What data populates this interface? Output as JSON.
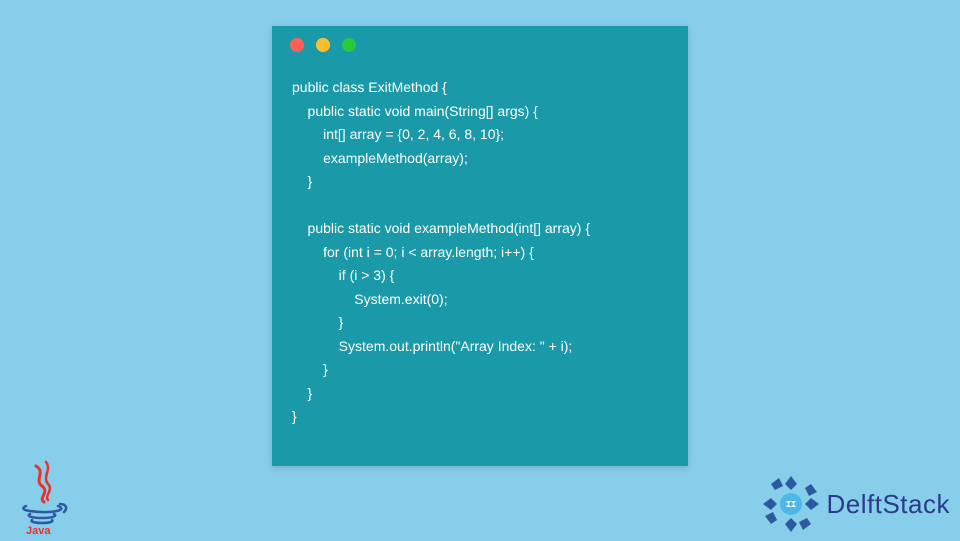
{
  "window": {
    "dots": [
      "red",
      "yellow",
      "green"
    ]
  },
  "code": {
    "lines": [
      "public class ExitMethod {",
      "    public static void main(String[] args) {",
      "        int[] array = {0, 2, 4, 6, 8, 10};",
      "        exampleMethod(array);",
      "    }",
      "",
      "    public static void exampleMethod(int[] array) {",
      "        for (int i = 0; i < array.length; i++) {",
      "            if (i > 3) {",
      "                System.exit(0);",
      "            }",
      "            System.out.println(\"Array Index: \" + i);",
      "        }",
      "    }",
      "}"
    ]
  },
  "logos": {
    "java_label": "Java",
    "delft_label": "DelftStack"
  },
  "colors": {
    "bg": "#87CEEB",
    "window": "#1A99A8",
    "text": "#FFFFFF",
    "delft": "#2B3A8B"
  }
}
